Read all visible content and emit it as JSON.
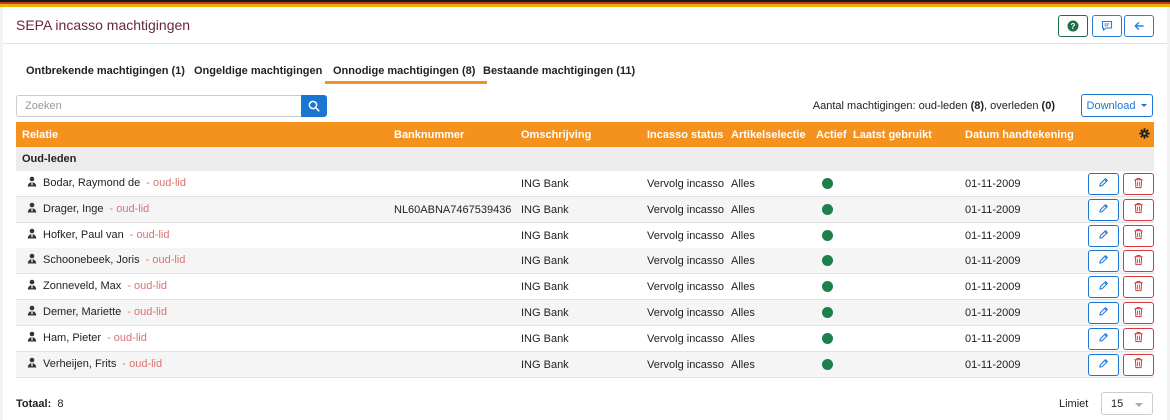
{
  "header": {
    "title": "SEPA incasso machtigingen",
    "help_icon": "help-icon",
    "feedback_icon": "comment-icon",
    "back_icon": "arrow-left-icon"
  },
  "tabs": [
    {
      "label": "Ontbrekende machtigingen (1)",
      "active": false
    },
    {
      "label": "Ongeldige machtigingen",
      "active": false
    },
    {
      "label": "Onnodige machtigingen (8)",
      "active": true
    },
    {
      "label": "Bestaande machtigingen (11)",
      "active": false
    }
  ],
  "search": {
    "placeholder": "Zoeken",
    "value": ""
  },
  "summary": {
    "prefix": "Aantal machtigingen: oud-leden",
    "oud_leden": "(8)",
    "middle": ", overleden",
    "overleden": "(0)"
  },
  "download": {
    "label": "Download"
  },
  "table": {
    "columns": [
      "Relatie",
      "Banknummer",
      "Omschrijving",
      "Incasso status",
      "Artikelselectie",
      "Actief",
      "Laatst gebruikt",
      "Datum handtekening"
    ],
    "group_label": "Oud-leden",
    "rows": [
      {
        "name": "Bodar, Raymond de",
        "sub": "- oud-lid",
        "bank": "",
        "description": "ING Bank",
        "status": "Vervolg incasso",
        "selection": "Alles",
        "active": true,
        "last_used": "",
        "signed": "01-11-2009"
      },
      {
        "name": "Drager, Inge",
        "sub": "- oud-lid",
        "bank": "NL60ABNA7467539436",
        "description": "ING Bank",
        "status": "Vervolg incasso",
        "selection": "Alles",
        "active": true,
        "last_used": "",
        "signed": "01-11-2009"
      },
      {
        "name": "Hofker, Paul van",
        "sub": "- oud-lid",
        "bank": "",
        "description": "ING Bank",
        "status": "Vervolg incasso",
        "selection": "Alles",
        "active": true,
        "last_used": "",
        "signed": "01-11-2009"
      },
      {
        "name": "Schoonebeek, Joris",
        "sub": "- oud-lid",
        "bank": "",
        "description": "ING Bank",
        "status": "Vervolg incasso",
        "selection": "Alles",
        "active": true,
        "last_used": "",
        "signed": "01-11-2009"
      },
      {
        "name": "Zonneveld, Max",
        "sub": "- oud-lid",
        "bank": "",
        "description": "ING Bank",
        "status": "Vervolg incasso",
        "selection": "Alles",
        "active": true,
        "last_used": "",
        "signed": "01-11-2009"
      },
      {
        "name": "Demer, Mariette",
        "sub": "- oud-lid",
        "bank": "",
        "description": "ING Bank",
        "status": "Vervolg incasso",
        "selection": "Alles",
        "active": true,
        "last_used": "",
        "signed": "01-11-2009"
      },
      {
        "name": "Ham, Pieter",
        "sub": "- oud-lid",
        "bank": "",
        "description": "ING Bank",
        "status": "Vervolg incasso",
        "selection": "Alles",
        "active": true,
        "last_used": "",
        "signed": "01-11-2009"
      },
      {
        "name": "Verheijen, Frits",
        "sub": "- oud-lid",
        "bank": "",
        "description": "ING Bank",
        "status": "Vervolg incasso",
        "selection": "Alles",
        "active": true,
        "last_used": "",
        "signed": "01-11-2009"
      }
    ]
  },
  "footer": {
    "total_label": "Totaal:",
    "total_value": "8",
    "limit_label": "Limiet",
    "limit_value": "15"
  },
  "colors": {
    "accent": "#f5921e",
    "title": "#6b2440",
    "primary": "#1b76d1",
    "danger": "#d23c3c",
    "active_dot": "#1e7e4c",
    "sub_text": "#d9736f"
  }
}
